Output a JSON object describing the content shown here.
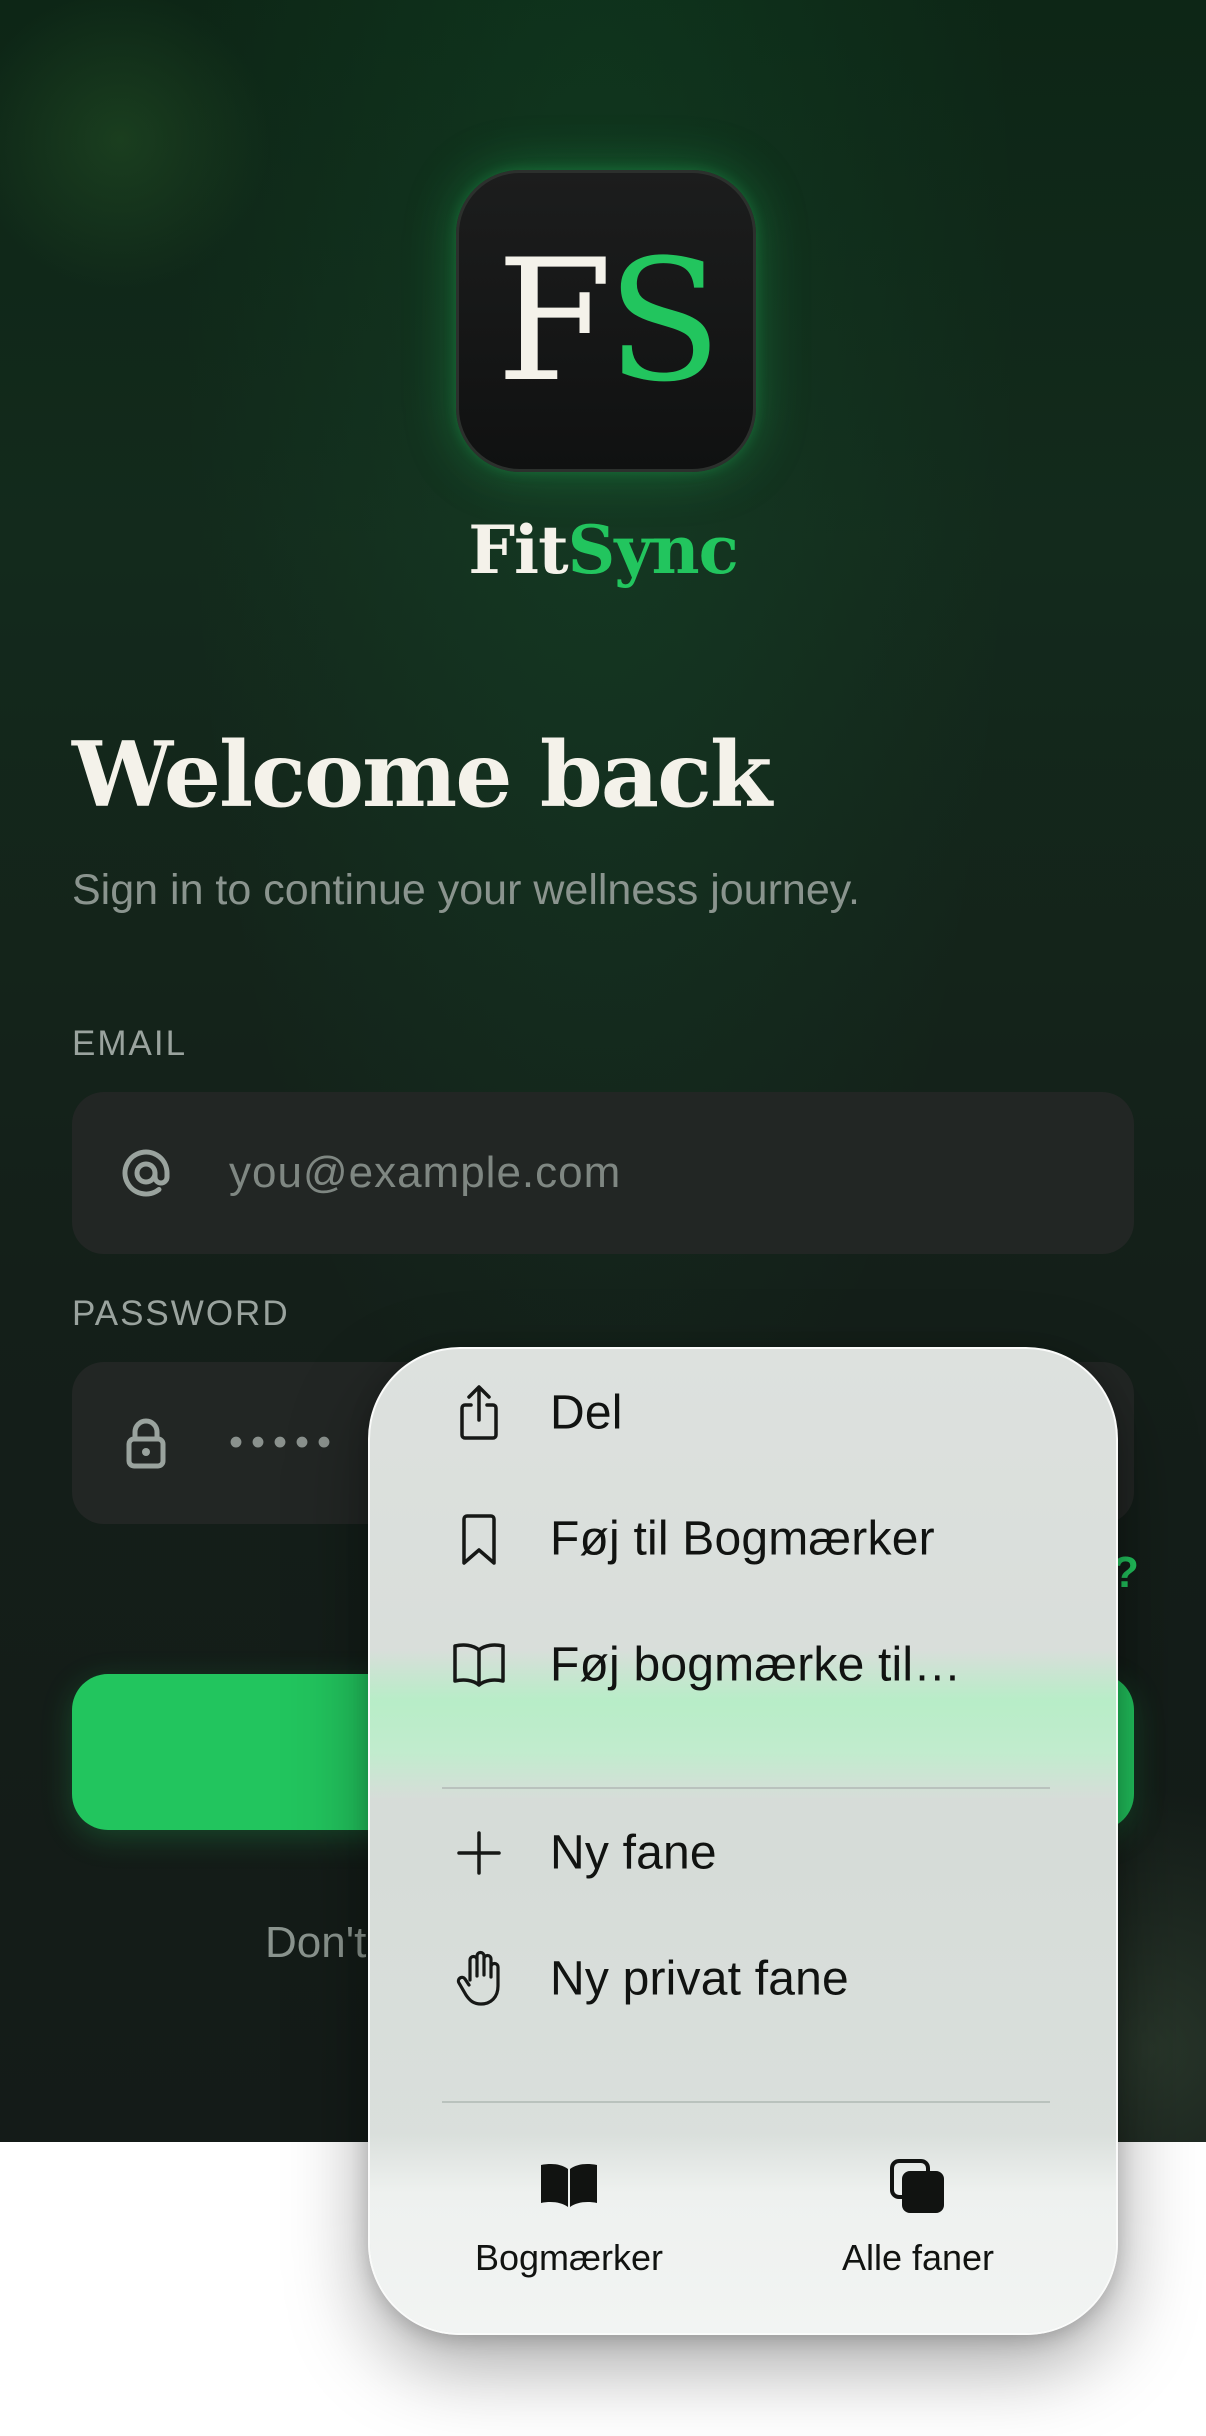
{
  "app": {
    "logo_letters": {
      "first": "F",
      "second": "S"
    },
    "brand": {
      "part1": "Fit",
      "part2": "Sync"
    },
    "heading": "Welcome back",
    "subtitle": "Sign in to continue your wellness journey.",
    "email": {
      "label": "EMAIL",
      "placeholder": "you@example.com",
      "icon": "at-icon"
    },
    "password": {
      "label": "PASSWORD",
      "masked_value": "•••••",
      "icon": "lock-icon"
    },
    "forgot_visible_fragment": "?",
    "signup_visible_fragment": "Don't",
    "colors": {
      "accent": "#22c55e",
      "background": "#141f19",
      "field": "#222624",
      "text": "#f4f2ea"
    }
  },
  "menu": {
    "items": [
      {
        "label": "Del",
        "icon": "share-icon"
      },
      {
        "label": "Føj til Bogmærker",
        "icon": "bookmark-icon"
      },
      {
        "label": "Føj bogmærke til…",
        "icon": "open-book-icon"
      },
      {
        "label": "Ny fane",
        "icon": "plus-icon"
      },
      {
        "label": "Ny privat fane",
        "icon": "hand-icon"
      }
    ],
    "bottom": [
      {
        "label": "Bogmærker",
        "icon": "book-icon"
      },
      {
        "label": "Alle faner",
        "icon": "tabs-icon"
      }
    ]
  }
}
